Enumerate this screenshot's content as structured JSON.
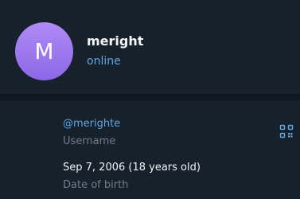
{
  "profile": {
    "avatar_letter": "M",
    "name": "meright",
    "status": "online"
  },
  "details": [
    {
      "value": "@merighte",
      "label": "Username"
    },
    {
      "value": "Sep 7, 2006 (18 years old)",
      "label": "Date of birth"
    }
  ],
  "icons": {
    "qr": "qr-code-icon"
  },
  "colors": {
    "background": "#16212c",
    "avatar_top": "#b08bf5",
    "avatar_bottom": "#8c67e6",
    "accent": "#5ea6e5",
    "muted": "#6f7c89",
    "text": "#f2f4f6"
  }
}
